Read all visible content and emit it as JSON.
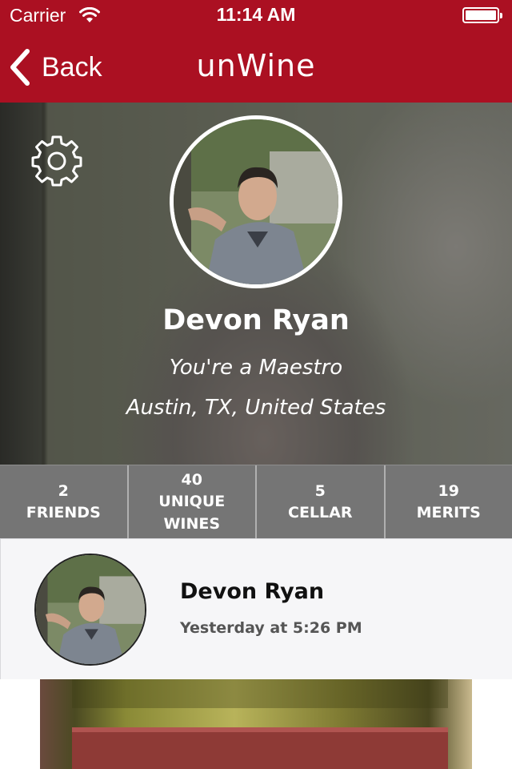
{
  "colors": {
    "brand": "#ab1022",
    "stats_bar": "#6e6e6e",
    "feed_bg": "#f6f6f8"
  },
  "status_bar": {
    "carrier": "Carrier",
    "time": "11:14 AM"
  },
  "nav": {
    "back_label": "Back",
    "logo_text": "unWine"
  },
  "profile": {
    "name": "Devon Ryan",
    "rank": "You're a Maestro",
    "location": "Austin, TX, United States"
  },
  "stats": [
    {
      "value": "2",
      "label": "FRIENDS"
    },
    {
      "value": "40",
      "label": "UNIQUE WINES"
    },
    {
      "value": "5",
      "label": "CELLAR"
    },
    {
      "value": "19",
      "label": "MERITS"
    }
  ],
  "feed": {
    "author": "Devon Ryan",
    "timestamp": "Yesterday at 5:26 PM"
  },
  "icons": {
    "back": "chevron-left-icon",
    "settings": "gear-icon",
    "wifi": "wifi-icon",
    "battery": "battery-icon"
  }
}
